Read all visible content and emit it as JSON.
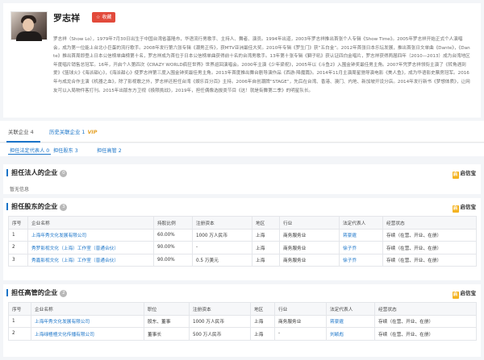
{
  "profile": {
    "name": "罗志祥",
    "fav_label": "收藏",
    "bio": "罗志祥（Show Lo），1979年7月30日出生于中国台湾省基隆市，华语流行男歌手、主持人、舞者、演员。1994年出道，2003年罗志祥推出首张个人专辑《Show Time》。2005年罗志祥开始正式个人演唱会，成为第一位能上台北小巨蛋的流行歌手。2008年发行第六张专辑《潮男正传》，获MTV亚洲最佳大奖。2010年专辑《罗生门》获“五白金”。2012年首张日本乐坛发展，推出首张日文单曲《Dante》，《Dante》推出首周即登上日本公信榜单曲榜第十名，罗志祥成为首位于日本公信榜单曲获得前十名的台湾男歌手。13年第十张专辑《獅子吼》获认证四白金唱片，罗志祥获得两届四年（2010—2013）成为台湾地区年度唱片销售总冠军。16年，开启个人第四次《CRAZY WORLD疯狂世界》世界巡回演唱会。2000年主演《少年梁祝》，2005年以《斗鱼2》入围金钟奖最佳男主角。2007年凭罗志祥领衔主演了《转角遇到爱》《篮球火》《海派甜心》，《海派甜心》使罗志祥第三度入围金钟奖最佳男主角。2013年首度推出舞台剧导演作品《西游·降魔篇》。2014年11月主演周星驰导演电影《美人鱼》，成为华语影史票房冠军。2016年与成龙合作主演《机器之血》，除了影视歌之外，罗志祥还担任台湾《娱乐百分百》主持。2006年自创潮牌“STAGE”，先后在台湾、香港、澳门、内地、新加坡开设分店。2014年发行新书《梦想体质》，让网友可以入局物件客打刊。2015年出版东方卫视《极限挑战》，2019年，担任偶像选拔类节目《这！就是街舞第二季》的明星队长。"
  },
  "tabs": {
    "related": "关联企业 4",
    "history": "历史关联企业 1",
    "vip": "VIP"
  },
  "subtabs": [
    "担任法定代表人 0",
    "担任股东 3",
    "担任高管 2"
  ],
  "brand": "启信宝",
  "brand_badge": "启",
  "section_legal": {
    "title": "担任法人的企业",
    "count": "0",
    "empty": "暂无信息"
  },
  "section_holder": {
    "title": "担任股东的企业",
    "count": "3",
    "headers": [
      "序号",
      "企业名称",
      "持股比例",
      "注册资本",
      "地区",
      "行业",
      "法定代表人",
      "经营状态"
    ],
    "rows": [
      [
        "1",
        "上海年秀文化发展有限公司",
        "60.00%",
        "1000 万人民币",
        "上海",
        "商务服务业",
        "蒋豪霆",
        "存续（在营、开业、在册）"
      ],
      [
        "2",
        "秀罗影视文化（上海）工作室（普通合伙）",
        "90.00%",
        "-",
        "上海",
        "商务服务业",
        "徐子乔",
        "存续（在营、开业、在册）"
      ],
      [
        "3",
        "秀嘉影视文化（上海）工作室（普通合伙）",
        "90.00%",
        "0.5 万美元",
        "上海",
        "商务服务业",
        "徐子乔",
        "存续（在营、开业、在册）"
      ]
    ]
  },
  "section_exec": {
    "title": "担任高管的企业",
    "count": "2",
    "headers": [
      "序号",
      "企业名称",
      "职位",
      "注册资本",
      "地区",
      "行业",
      "法定代表人",
      "经营状态"
    ],
    "rows": [
      [
        "1",
        "上海年秀文化发展有限公司",
        "股东、董事",
        "1000 万人民币",
        "上海",
        "商务服务业",
        "蒋豪霆",
        "存续（在营、开业、在册）"
      ],
      [
        "2",
        "上海绿楂楂文化传播有限公司",
        "董事长",
        "500 万人民币",
        "上海",
        "-",
        "刘颖彪",
        "存续（在营、开业、在册）"
      ]
    ]
  },
  "colors": {
    "accent": "#1a74c8",
    "fav": "#e24a3b",
    "vip": "#e5a126",
    "brand_badge": "#f4b321"
  },
  "icons": [
    "star-icon",
    "qixinbao-logo-icon"
  ]
}
